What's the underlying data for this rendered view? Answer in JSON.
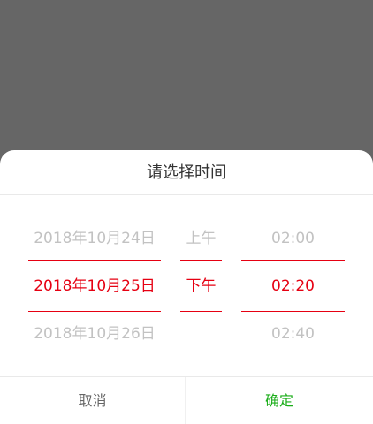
{
  "dialog": {
    "title": "请选择时间"
  },
  "picker": {
    "date_column": {
      "prev": "2018年10月24日",
      "selected": "2018年10月25日",
      "next": "2018年10月26日"
    },
    "ampm_column": {
      "prev": "上午",
      "selected": "下午",
      "next": ""
    },
    "time_column": {
      "prev": "02:00",
      "selected": "02:20",
      "next": "02:40"
    }
  },
  "actions": {
    "cancel_label": "取消",
    "confirm_label": "确定"
  },
  "colors": {
    "overlay": "#666666",
    "selected_text": "#e60012",
    "unselected_text": "#c2c2c2",
    "confirm_text": "#1aad19",
    "cancel_text": "#666666"
  }
}
